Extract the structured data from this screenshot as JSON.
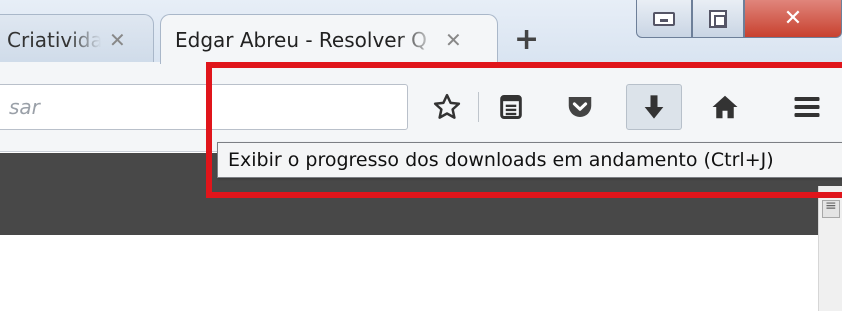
{
  "tabs": [
    {
      "title": "Criatividade",
      "close": "✕",
      "active": false
    },
    {
      "title": "Edgar Abreu - Resolver Q",
      "close": "✕",
      "active": true
    }
  ],
  "new_tab_label": "+",
  "window_controls": {
    "close_glyph": "✕"
  },
  "search": {
    "placeholder": "sar"
  },
  "toolbar": {
    "buttons": [
      {
        "name": "bookmark",
        "icon": "star-icon"
      },
      {
        "name": "reading-list",
        "icon": "reader-icon"
      },
      {
        "name": "pocket",
        "icon": "pocket-icon"
      },
      {
        "name": "downloads",
        "icon": "download-arrow-icon",
        "pressed": true
      },
      {
        "name": "home",
        "icon": "home-icon"
      },
      {
        "name": "menu",
        "icon": "hamburger-icon"
      }
    ]
  },
  "tooltip": {
    "text": "Exibir o progresso dos downloads em andamento (Ctrl+J)"
  },
  "colors": {
    "highlight": "#e0151b",
    "page_dark_bar": "#484848",
    "close_button": "#c8412f"
  }
}
